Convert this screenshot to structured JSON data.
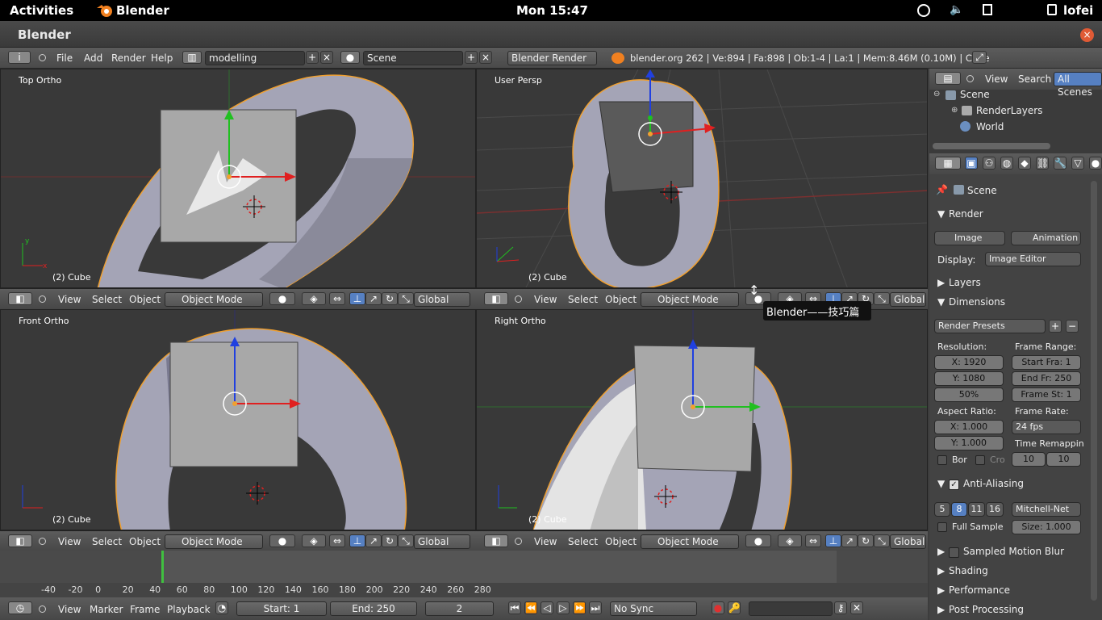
{
  "topbar": {
    "activities": "Activities",
    "app": "Blender",
    "clock": "Mon 15:47",
    "user": "lofei"
  },
  "window": {
    "title": "Blender",
    "close": "×"
  },
  "info": {
    "menus": [
      "File",
      "Add",
      "Render",
      "Help"
    ],
    "layout": "modelling",
    "scene": "Scene",
    "engine": "Blender Render",
    "stats": "blender.org 262 | Ve:894 | Fa:898 | Ob:1-4 | La:1 | Mem:8.46M (0.10M) | Cube"
  },
  "viewports": [
    {
      "label": "Top Ortho",
      "object": "(2) Cube"
    },
    {
      "label": "User Persp",
      "object": "(2) Cube"
    },
    {
      "label": "Front Ortho",
      "object": "(2) Cube"
    },
    {
      "label": "Right Ortho",
      "object": "(2) Cube"
    }
  ],
  "vpheader": {
    "view": "View",
    "select": "Select",
    "object": "Object",
    "mode": "Object Mode",
    "orientation": "Global"
  },
  "tooltip": "Blender——技巧篇",
  "timeline": {
    "ticks": [
      "-40",
      "-20",
      "0",
      "20",
      "40",
      "60",
      "80",
      "100",
      "120",
      "140",
      "160",
      "180",
      "200",
      "220",
      "240",
      "260",
      "280"
    ],
    "menus": [
      "View",
      "Marker",
      "Frame",
      "Playback"
    ],
    "start": "Start: 1",
    "end": "End: 250",
    "current": "2",
    "sync": "No Sync"
  },
  "outliner": {
    "menus": [
      "View",
      "Search"
    ],
    "filter": "All Scenes",
    "items": [
      "Scene",
      "RenderLayers",
      "World"
    ]
  },
  "props": {
    "context": "Scene",
    "render_title": "Render",
    "image_btn": "Image",
    "anim_btn": "Animation",
    "display_label": "Display:",
    "display_value": "Image Editor",
    "layers": "Layers",
    "dimensions": "Dimensions",
    "presets": "Render Presets",
    "resolution": "Resolution:",
    "res_x": "X: 1920",
    "res_y": "Y: 1080",
    "res_pct": "50%",
    "frame_range": "Frame Range:",
    "start_fra": "Start Fra: 1",
    "end_fr": "End Fr: 250",
    "frame_st": "Frame St: 1",
    "aspect": "Aspect Ratio:",
    "asp_x": "X: 1.000",
    "asp_y": "Y: 1.000",
    "frame_rate": "Frame Rate:",
    "fps": "24 fps",
    "remap": "Time Remappin",
    "remap_old": "10",
    "remap_new": "10",
    "border": "Bor",
    "crop": "Cro",
    "aa": "Anti-Aliasing",
    "aa_samples": [
      "5",
      "8",
      "11",
      "16"
    ],
    "aa_filter": "Mitchell-Net",
    "full_sample": "Full Sample",
    "aa_size": "Size: 1.000",
    "motion_blur": "Sampled Motion Blur",
    "shading": "Shading",
    "performance": "Performance",
    "post": "Post Processing"
  },
  "colors": {
    "accent": "#5680c2",
    "x_axis": "#e02020",
    "y_axis": "#20c020",
    "z_axis": "#2040e0",
    "select": "#f0a030"
  }
}
